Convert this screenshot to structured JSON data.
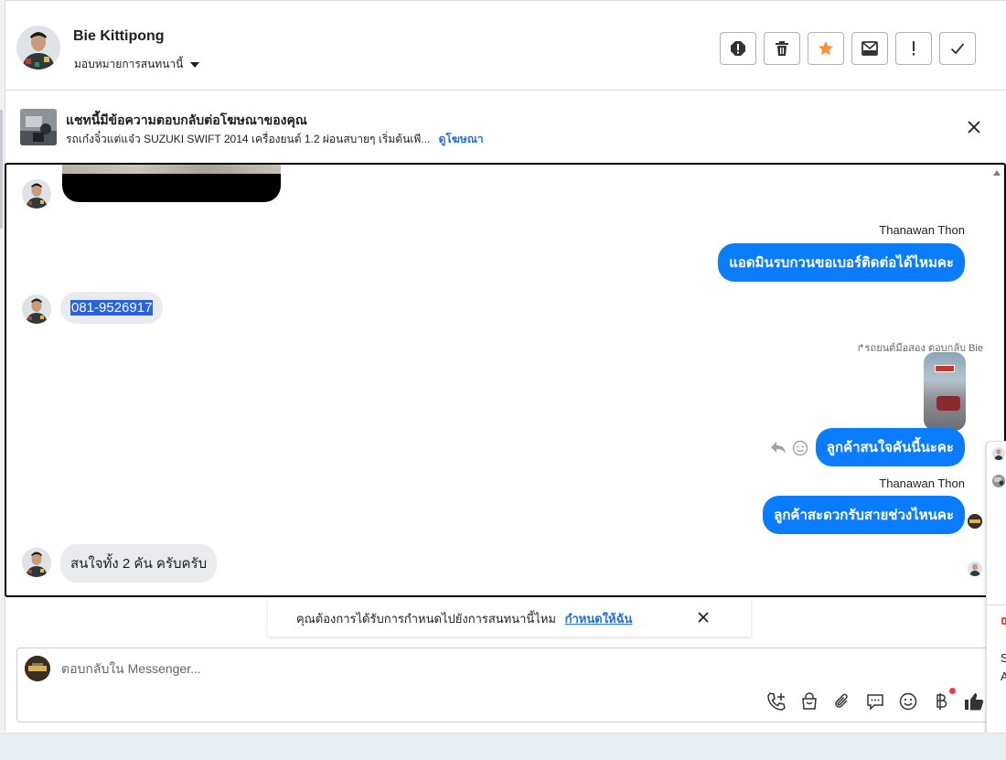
{
  "header": {
    "contact_name": "Bie Kittipong",
    "assign_label": "มอบหมายการสนทนานี้",
    "toolbar": [
      "spam-icon",
      "trash-icon",
      "star-icon",
      "move-to-inbox-icon",
      "mark-important-icon",
      "done-check-icon"
    ]
  },
  "ad_banner": {
    "title": "แชทนี้มีข้อความตอบกลับต่อโฆษณาของคุณ",
    "subtitle": "รถเก๋งจิ๋วแต่แจ๋ว SUZUKI SWIFT 2014 เครื่องยนต์ 1.2 ผ่อนสบายๆ เริ่มต้นเพี...",
    "link": "ดูโฆษณา"
  },
  "messages": {
    "sender_1": "Thanawan Thon",
    "out_1": "แอดมินรบกวนขอเบอร์ติดต่อได้ไหมคะ",
    "in_phone": "081-9526917",
    "reply_note": "รถยนต์มือสอง ตอบกลับ Bie",
    "out_2": "ลูกค้าสนใจคันนี้นะคะ",
    "sender_2": "Thanawan Thon",
    "out_3": "ลูกค้าสะดวกรับสายช่วงไหนคะ",
    "in_last": "สนใจทั้ง 2 คัน ครับครับ"
  },
  "notice": {
    "text": "คุณต้องการได้รับการกำหนดไปยังการสนทนานี้ไหม",
    "link": "กำหนดให้ฉัน"
  },
  "composer": {
    "placeholder": "ตอบกลับใน Messenger..."
  },
  "right_panel": {
    "line1": "S",
    "line2": "A"
  },
  "colors": {
    "accent": "#0a7cff",
    "link": "#216fdb",
    "star": "#f7923b"
  }
}
